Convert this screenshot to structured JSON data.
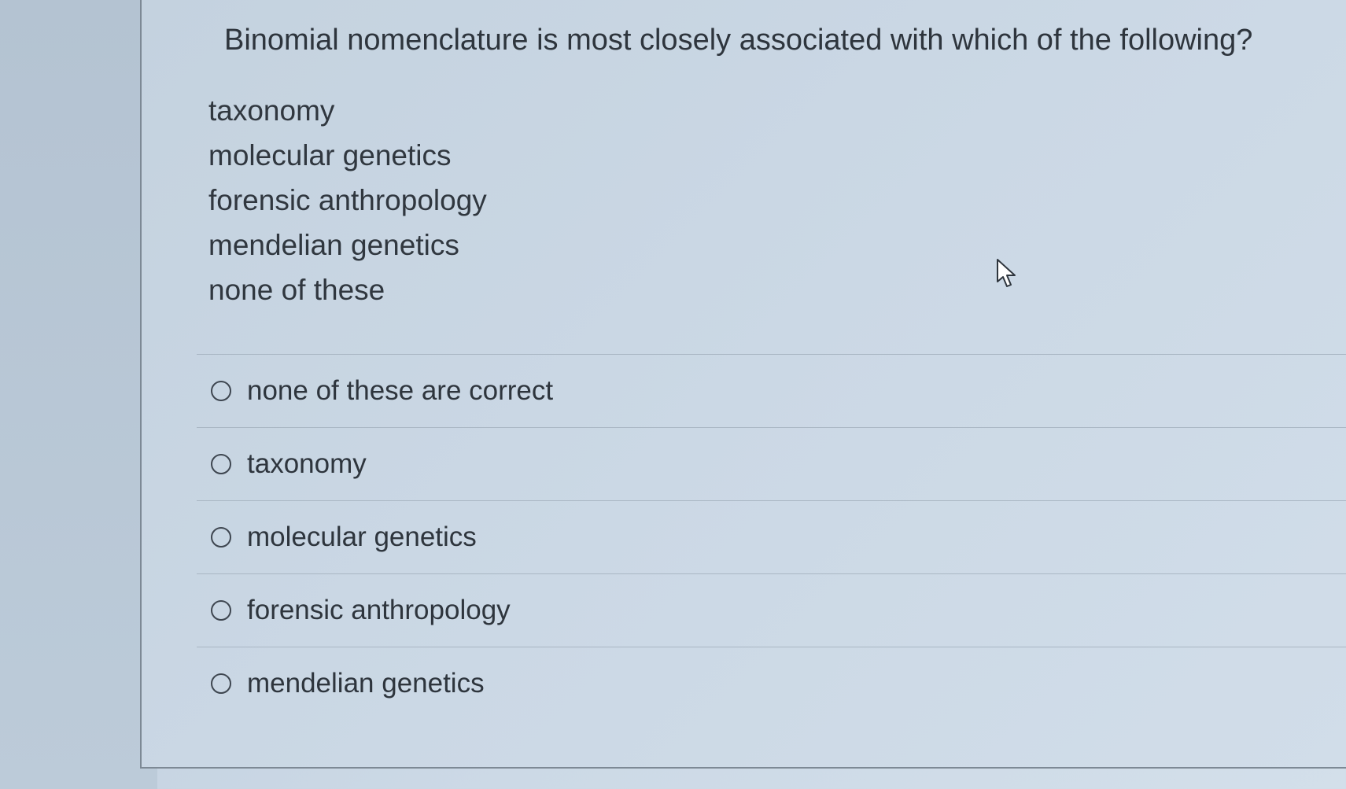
{
  "question": {
    "text": "Binomial nomenclature is most closely associated with which of the following?"
  },
  "terms": [
    "taxonomy",
    "molecular genetics",
    "forensic anthropology",
    "mendelian genetics",
    "none of these"
  ],
  "answer_options": [
    {
      "label": "none of these are correct",
      "selected": false
    },
    {
      "label": "taxonomy",
      "selected": false
    },
    {
      "label": "molecular genetics",
      "selected": false
    },
    {
      "label": "forensic anthropology",
      "selected": false
    },
    {
      "label": "mendelian genetics",
      "selected": false
    }
  ],
  "icons": {
    "cursor": "mouse-pointer-icon",
    "radio": "radio-unchecked-icon"
  }
}
